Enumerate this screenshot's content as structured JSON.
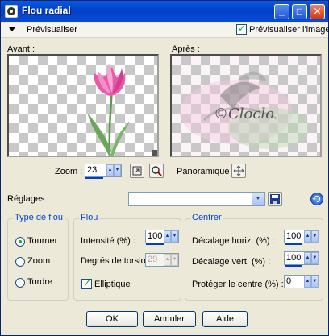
{
  "window": {
    "title": "Flou radial",
    "minimize": "_",
    "maximize": "□",
    "close": "✕"
  },
  "preview_toggle": {
    "label": "Prévisualiser",
    "checkbox_label": "Prévisualiser l'image",
    "checked": true
  },
  "before_label": "Avant :",
  "after_label": "Après :",
  "watermark_text": "©Cloclo",
  "zoom": {
    "label": "Zoom :",
    "value": "23"
  },
  "pan_label": "Panoramique :",
  "presets": {
    "label": "Réglages",
    "value": ""
  },
  "blur_type": {
    "title": "Type de flou",
    "options": [
      {
        "label": "Tourner",
        "selected": true
      },
      {
        "label": "Zoom",
        "selected": false
      },
      {
        "label": "Tordre",
        "selected": false
      }
    ]
  },
  "blur": {
    "title": "Flou",
    "intensity_label": "Intensité (%) :",
    "intensity_value": "100",
    "twist_label": "Degrés de torsion :",
    "twist_value": "29",
    "elliptical_label": "Elliptique",
    "elliptical_checked": true
  },
  "center": {
    "title": "Centrer",
    "h_offset_label": "Décalage horiz. (%) :",
    "h_offset_value": "100",
    "v_offset_label": "Décalage vert. (%) :",
    "v_offset_value": "100",
    "protect_label": "Protéger le centre (%) :",
    "protect_value": "0"
  },
  "buttons": {
    "ok": "OK",
    "cancel": "Annuler",
    "help": "Aide"
  },
  "colors": {
    "titlebar": "#0a4bd6",
    "group_title": "#0046d5",
    "check": "#21a121",
    "tulip": "#e85aa8"
  }
}
